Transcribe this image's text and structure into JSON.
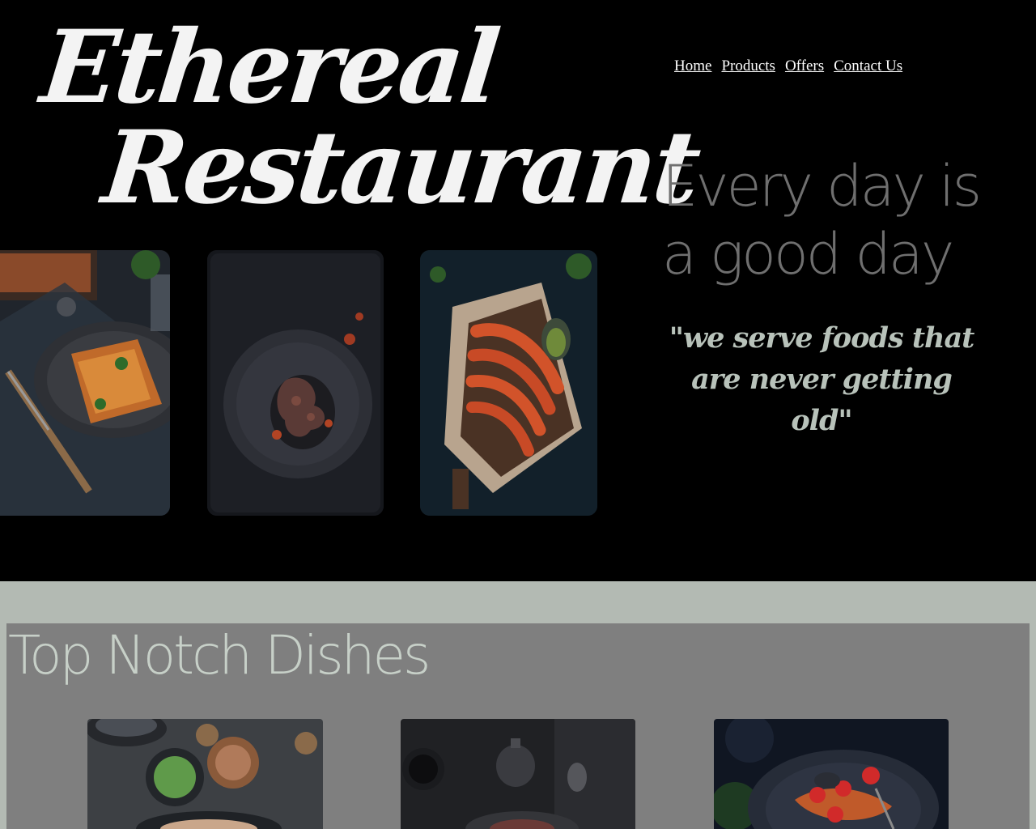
{
  "brand": {
    "line1": "Ethereal",
    "line2": "Restaurant"
  },
  "nav": {
    "items": [
      {
        "label": "Home"
      },
      {
        "label": "Products"
      },
      {
        "label": "Offers"
      },
      {
        "label": "Contact Us"
      }
    ]
  },
  "hero": {
    "tagline": "Every day is a good day",
    "quote": "\"we serve foods that are never getting old\""
  },
  "dishes": {
    "title": "Top Notch Dishes"
  },
  "colors": {
    "background": "#000000",
    "brand_text": "#f3f3f3",
    "tagline_text": "#6f6f6f",
    "quote_text": "#b8c2ba",
    "section_band": "#b3bab3",
    "section_panel": "#7f7f7f",
    "section_title": "#c7d0c8"
  },
  "images": [
    {
      "name": "lasagna-photo"
    },
    {
      "name": "octopus-pasta-photo"
    },
    {
      "name": "grilled-shrimp-photo"
    },
    {
      "name": "dish-spices-photo"
    },
    {
      "name": "dish-teapot-photo"
    },
    {
      "name": "dish-seafood-pasta-photo"
    }
  ]
}
